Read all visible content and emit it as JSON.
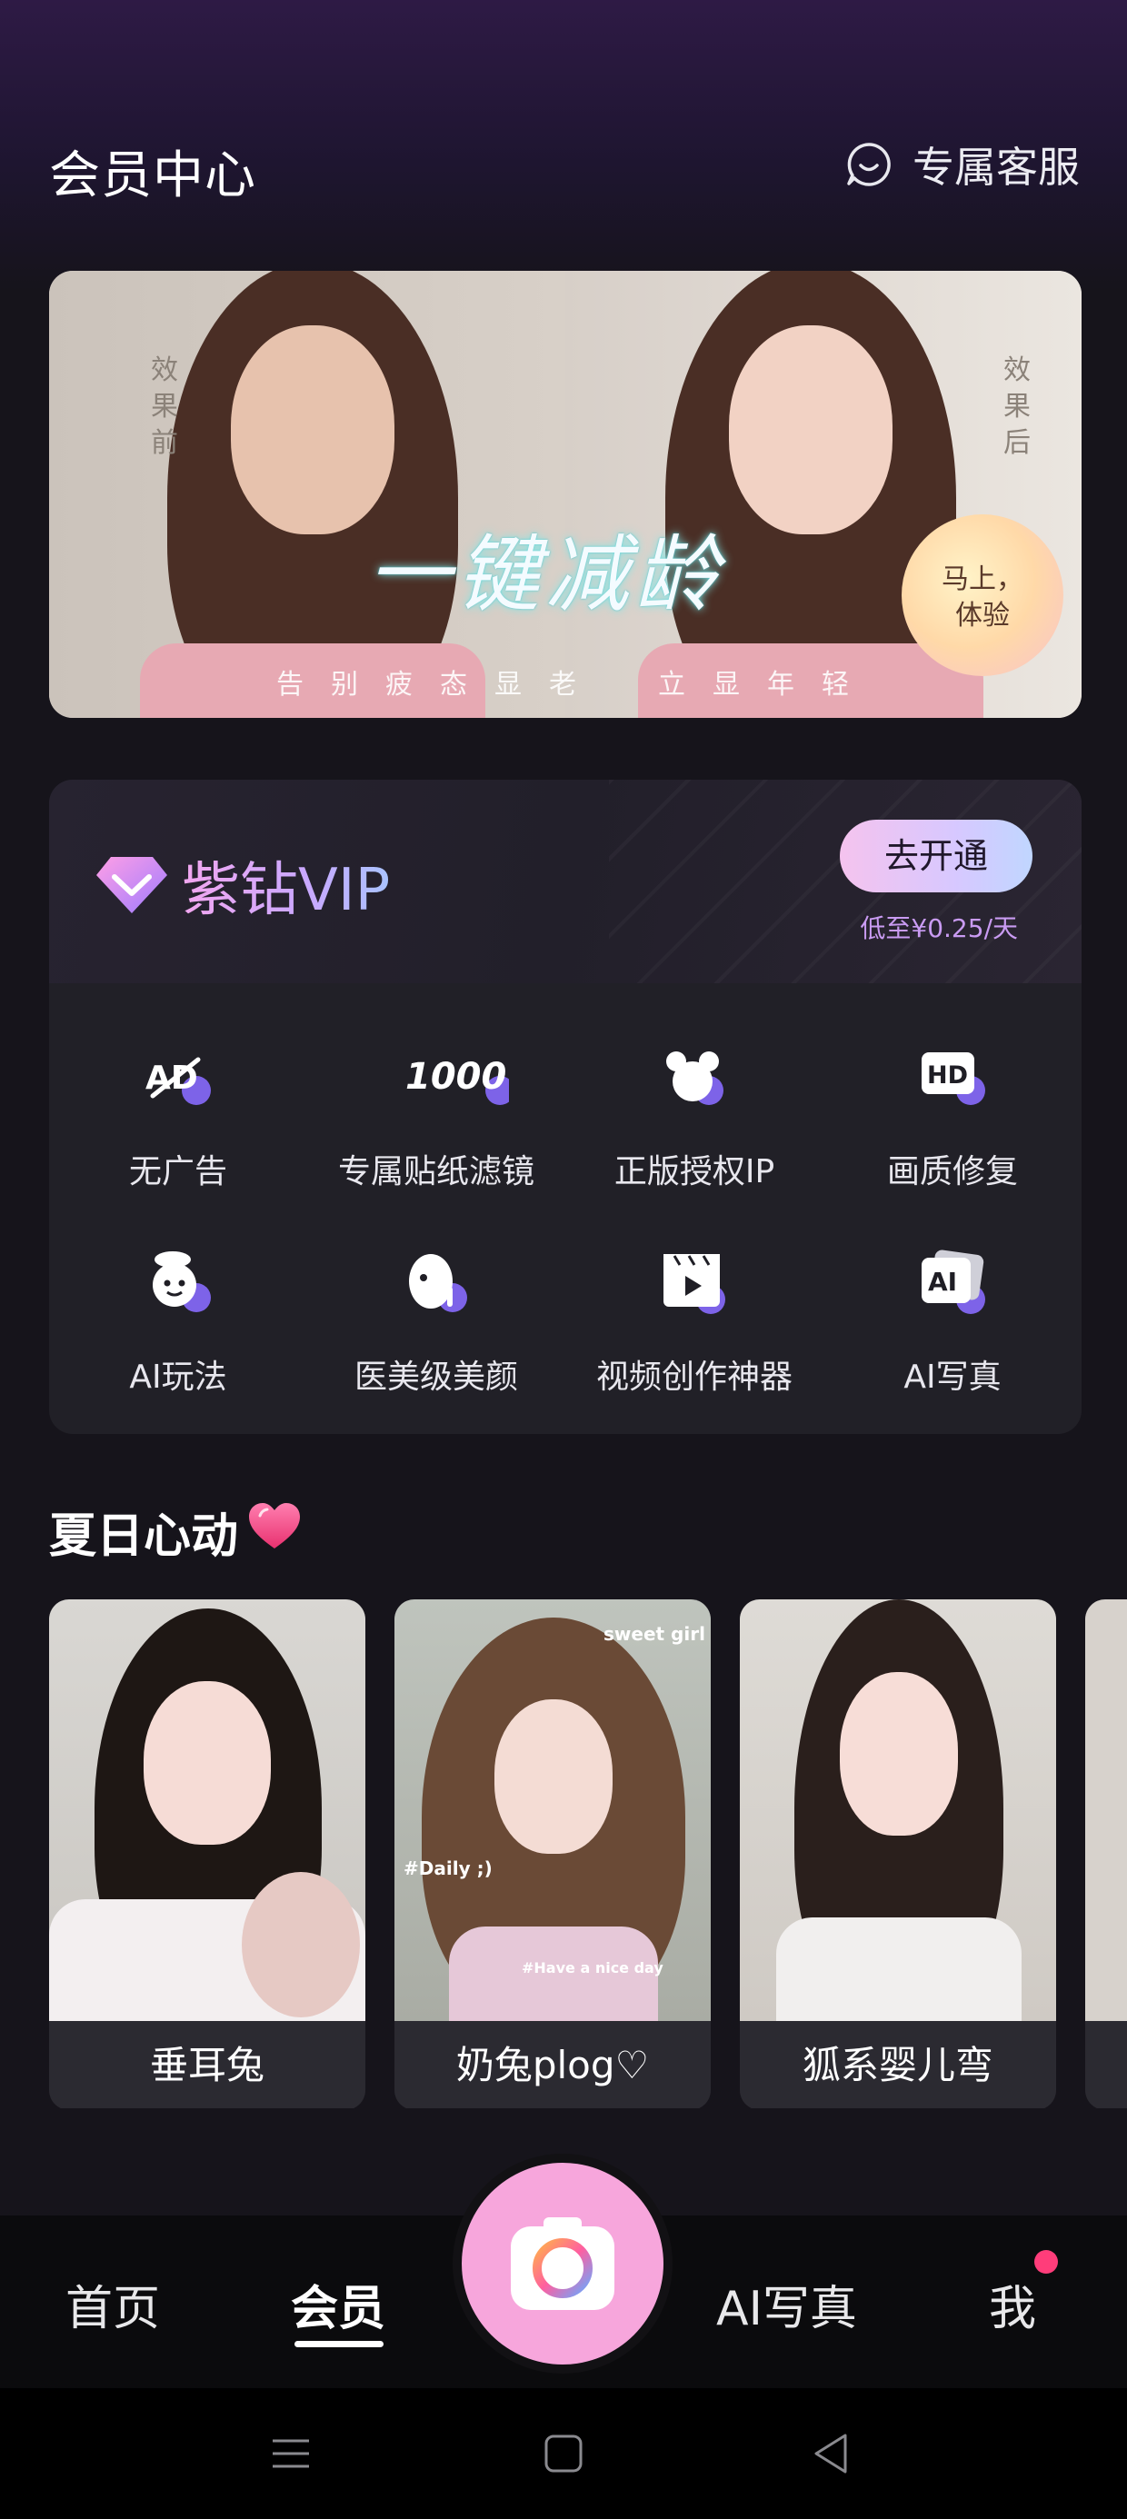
{
  "header": {
    "title": "会员中心",
    "support_label": "专属客服"
  },
  "banner": {
    "before_label": "效果前",
    "after_label": "效果后",
    "headline": "一键减龄",
    "sub_left": "告别疲态显老",
    "sub_right": "立显年轻",
    "cta_line1": "马上，",
    "cta_line2": "体验"
  },
  "vip": {
    "name": "紫钻VIP",
    "open_label": "去开通",
    "price_note": "低至¥0.25/天",
    "benefits": [
      {
        "label": "无广告",
        "icon": "no-ads-icon"
      },
      {
        "label": "专属贴纸滤镜",
        "icon": "stickers-1000-icon"
      },
      {
        "label": "正版授权IP",
        "icon": "licensed-ip-icon"
      },
      {
        "label": "画质修复",
        "icon": "hd-icon"
      },
      {
        "label": "AI玩法",
        "icon": "ai-play-icon"
      },
      {
        "label": "医美级美颜",
        "icon": "beauty-icon"
      },
      {
        "label": "视频创作神器",
        "icon": "video-icon"
      },
      {
        "label": "AI写真",
        "icon": "ai-portrait-icon"
      }
    ],
    "benefit_glyphs": {
      "no_ads": "AD",
      "stickers": "1000+",
      "hd": "HD",
      "ai": "AI"
    }
  },
  "section": {
    "title": "夏日心动"
  },
  "cards": [
    {
      "label": "垂耳兔"
    },
    {
      "label": "奶兔plog♡",
      "overlay_top": "sweet girl",
      "overlay_mid": "#Daily ;)",
      "overlay_bottom": "#Have a nice day"
    },
    {
      "label": "狐系婴儿弯"
    }
  ],
  "nav": {
    "home": "首页",
    "member": "会员",
    "ai_portrait": "AI写真",
    "me": "我",
    "active": "会员"
  },
  "colors": {
    "accent_pink": "#f7a6dc",
    "vip_gradient_start": "#f3a7f0",
    "vip_gradient_end": "#a9c3ff",
    "notify": "#ff3d7a",
    "price_note": "#c99bf2"
  }
}
